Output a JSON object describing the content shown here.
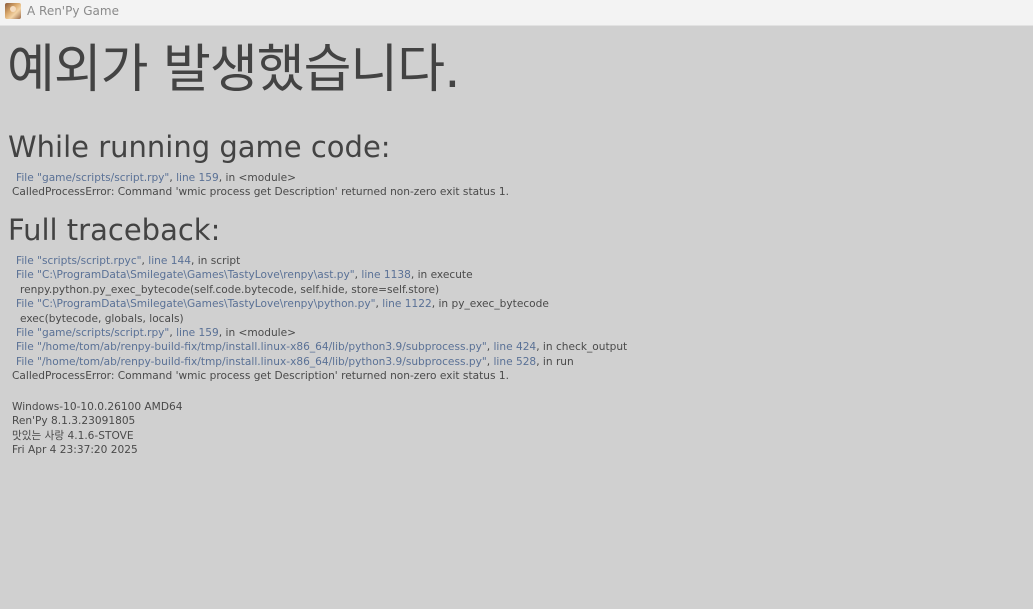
{
  "window": {
    "title": "A Ren'Py Game",
    "icon": "game-portrait-icon"
  },
  "heading": "예외가 발생했습니다.",
  "while_running": {
    "title": "While running game code:",
    "frame": {
      "file": "File \"game/scripts/script.rpy\"",
      "sep": ", ",
      "line": "line 159",
      "tail": ", in <module>"
    },
    "error": "CalledProcessError: Command 'wmic process get Description' returned non-zero exit status 1."
  },
  "full_traceback": {
    "title": "Full traceback:",
    "frames": [
      {
        "file": "File \"scripts/script.rpyc\"",
        "sep": ", ",
        "line": "line 144",
        "tail": ", in script",
        "code": ""
      },
      {
        "file": "File \"C:\\ProgramData\\Smilegate\\Games\\TastyLove\\renpy\\ast.py\"",
        "sep": ", ",
        "line": "line 1138",
        "tail": ", in execute",
        "code": "renpy.python.py_exec_bytecode(self.code.bytecode, self.hide, store=self.store)"
      },
      {
        "file": "File \"C:\\ProgramData\\Smilegate\\Games\\TastyLove\\renpy\\python.py\"",
        "sep": ", ",
        "line": "line 1122",
        "tail": ", in py_exec_bytecode",
        "code": "exec(bytecode, globals, locals)"
      },
      {
        "file": "File \"game/scripts/script.rpy\"",
        "sep": ", ",
        "line": "line 159",
        "tail": ", in <module>",
        "code": ""
      },
      {
        "file": "File \"/home/tom/ab/renpy-build-fix/tmp/install.linux-x86_64/lib/python3.9/subprocess.py\"",
        "sep": ", ",
        "line": "line 424",
        "tail": ", in check_output",
        "code": ""
      },
      {
        "file": "File \"/home/tom/ab/renpy-build-fix/tmp/install.linux-x86_64/lib/python3.9/subprocess.py\"",
        "sep": ", ",
        "line": "line 528",
        "tail": ", in run",
        "code": ""
      }
    ],
    "error": "CalledProcessError: Command 'wmic process get Description' returned non-zero exit status 1."
  },
  "system_info": [
    "Windows-10-10.0.26100 AMD64",
    "Ren'Py 8.1.3.23091805",
    "맛있는 사랑 4.1.6-STOVE",
    "Fri Apr  4 23:37:20 2025"
  ],
  "colors": {
    "background": "#d0d0d0",
    "titlebar": "#f3f3f3",
    "text": "#434343",
    "link": "#5a7196"
  }
}
